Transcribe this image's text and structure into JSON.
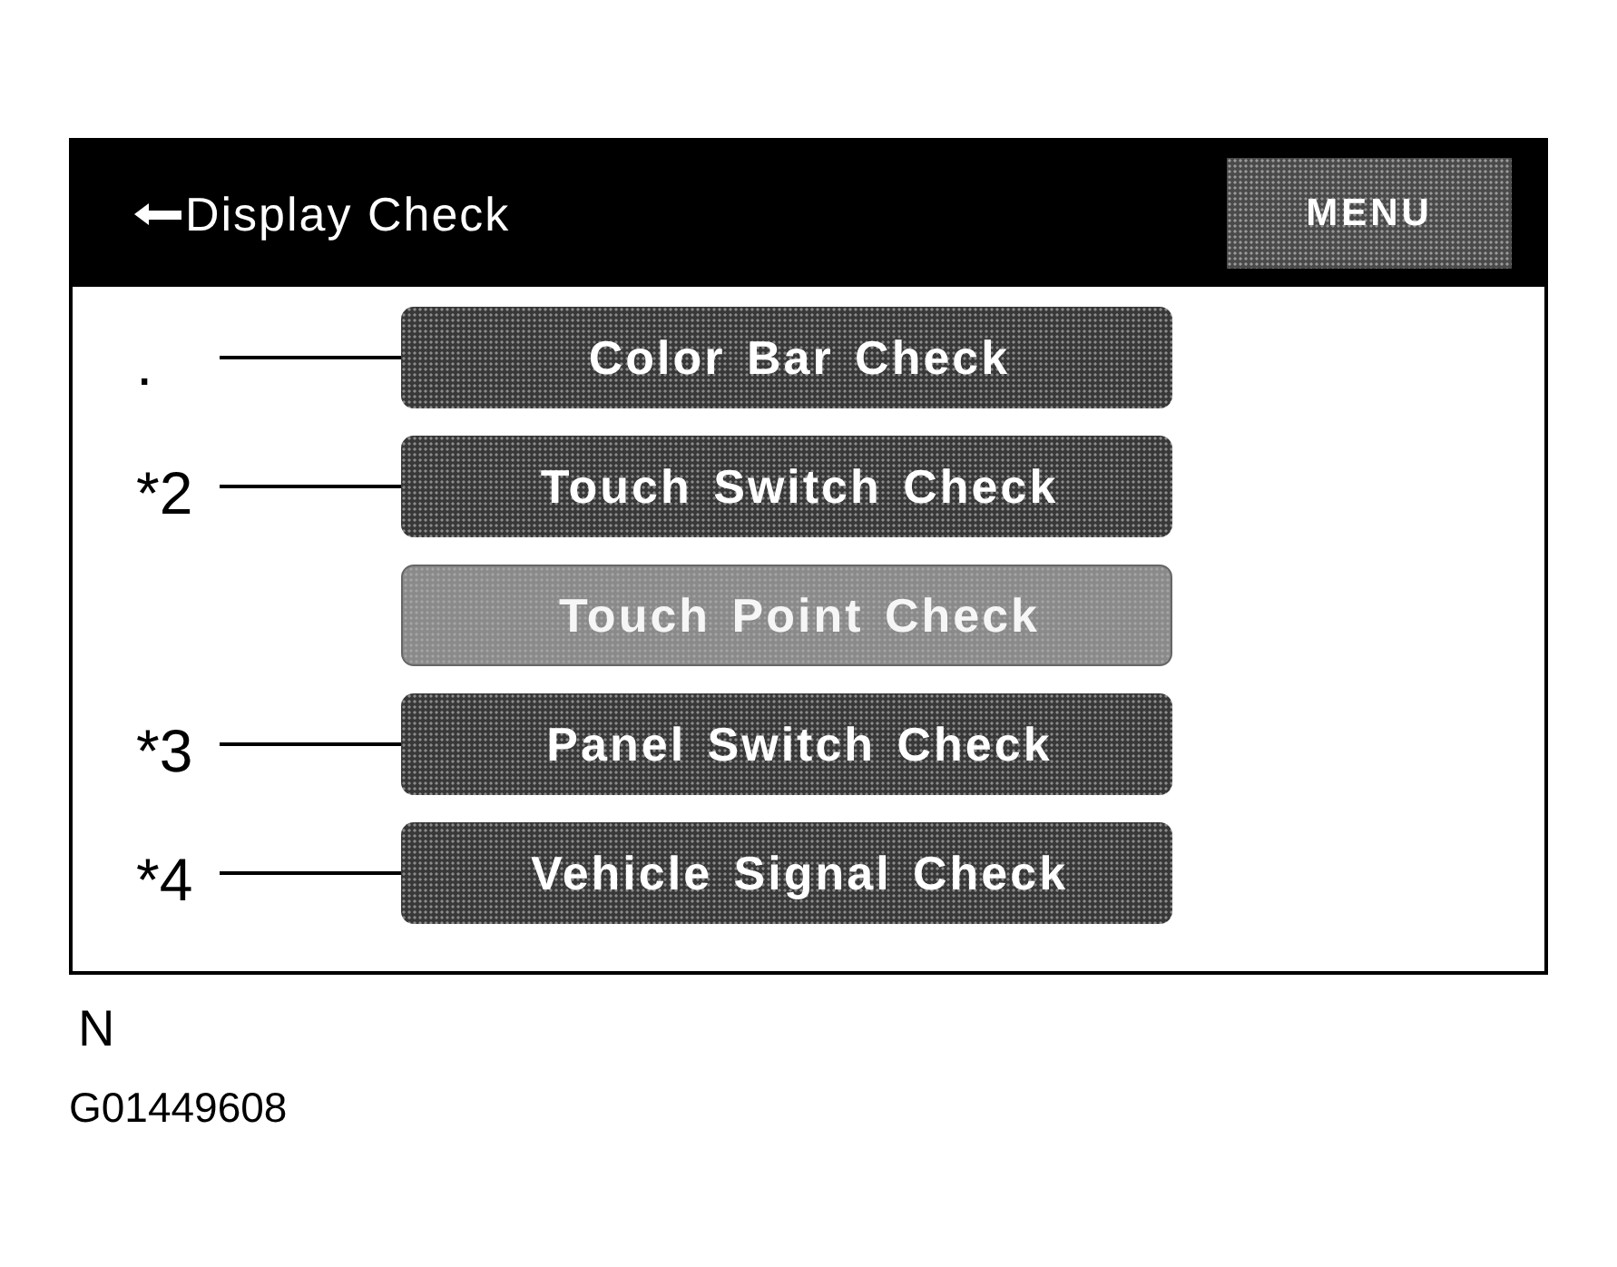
{
  "screen": {
    "title": "Display Check",
    "menu_button": "MENU"
  },
  "check_buttons": [
    {
      "label": "Color Bar Check",
      "callout": ".",
      "disabled": false
    },
    {
      "label": "Touch Switch Check",
      "callout": "*2",
      "disabled": false
    },
    {
      "label": "Touch Point Check",
      "disabled": true
    },
    {
      "label": "Panel Switch Check",
      "callout": "*3",
      "disabled": false
    },
    {
      "label": "Vehicle Signal Check",
      "callout": "*4",
      "disabled": false
    }
  ],
  "figure_label": "N",
  "figure_id": "G01449608"
}
